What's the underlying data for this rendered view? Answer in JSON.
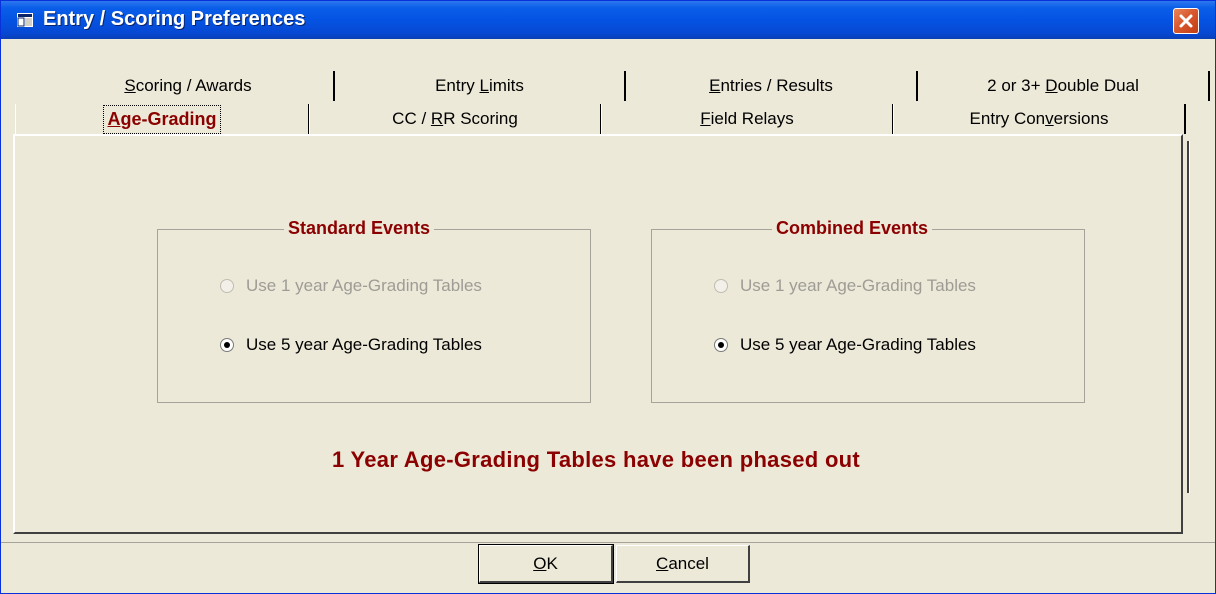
{
  "window": {
    "title": "Entry / Scoring Preferences",
    "icon": "app-window-icon",
    "close_icon": "close-icon"
  },
  "tabs_back_row": [
    {
      "pre": "",
      "u": "S",
      "post": "coring / Awards"
    },
    {
      "pre": "Entry ",
      "u": "L",
      "post": "imits"
    },
    {
      "pre": "",
      "u": "E",
      "post": "ntries / Results"
    },
    {
      "pre": "2 or 3+ ",
      "u": "D",
      "post": "ouble Dual"
    }
  ],
  "tabs_front_row": [
    {
      "pre": "",
      "u": "A",
      "post": "ge-Grading",
      "active": true
    },
    {
      "pre": "CC / ",
      "u": "R",
      "post": "R Scoring"
    },
    {
      "pre": "",
      "u": "F",
      "post": "ield Relays"
    },
    {
      "pre": "Entry Con",
      "u": "v",
      "post": "ersions"
    }
  ],
  "groups": {
    "standard": {
      "title": "Standard Events",
      "option1": "Use 1 year Age-Grading Tables",
      "option2": "Use 5 year Age-Grading Tables",
      "selected": "option2",
      "option1_disabled": true
    },
    "combined": {
      "title": "Combined Events",
      "option1": "Use 1 year Age-Grading Tables",
      "option2": "Use 5 year Age-Grading Tables",
      "selected": "option2",
      "option1_disabled": true
    }
  },
  "notice": "1 Year Age-Grading Tables have been phased out",
  "buttons": {
    "ok": {
      "pre": "",
      "u": "O",
      "post": "K"
    },
    "cancel": {
      "pre": "",
      "u": "C",
      "post": "ancel"
    }
  },
  "colors": {
    "titlebar": "#0553e3",
    "accent_text": "#8b0000",
    "dialog_bg": "#ece9d8"
  }
}
